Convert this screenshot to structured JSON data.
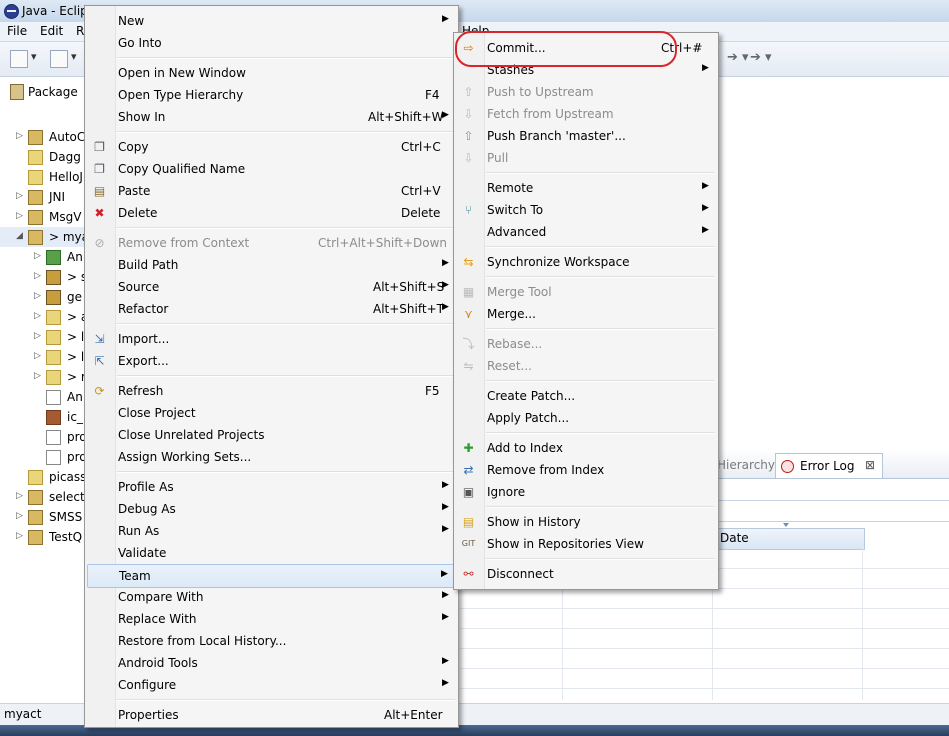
{
  "window": {
    "title": "Java - Eclip"
  },
  "menubar": {
    "items": [
      "File",
      "Edit",
      "R"
    ],
    "help": "Help"
  },
  "explorer": {
    "tab_label": "Package",
    "rows": [
      {
        "label": "AutoC",
        "top": 0
      },
      {
        "label": "Dagg",
        "top": 0
      },
      {
        "label": "HelloJ",
        "top": 0
      },
      {
        "label": "JNI",
        "top": 0
      },
      {
        "label": "MsgV",
        "top": 0
      },
      {
        "label": "> myac",
        "top": 0
      },
      {
        "label": "An",
        "top": 0
      },
      {
        "label": "> s",
        "top": 0
      },
      {
        "label": "ge",
        "top": 0
      },
      {
        "label": "> a",
        "top": 0
      },
      {
        "label": "> l",
        "top": 0
      },
      {
        "label": "> l",
        "top": 0
      },
      {
        "label": "> r",
        "top": 0
      },
      {
        "label": "An",
        "top": 0
      },
      {
        "label": "ic_",
        "top": 0
      },
      {
        "label": "pro",
        "top": 0
      },
      {
        "label": "pro",
        "top": 0
      },
      {
        "label": "picass",
        "top": 0
      },
      {
        "label": "select",
        "top": 0
      },
      {
        "label": "SMSS",
        "top": 0
      },
      {
        "label": "TestQ",
        "top": 0
      }
    ]
  },
  "context_menu": {
    "items": [
      {
        "label": "New",
        "shortcut": "",
        "submenu": true
      },
      {
        "label": "Go Into",
        "shortcut": ""
      },
      {
        "label": "Open in New Window",
        "shortcut": ""
      },
      {
        "label": "Open Type Hierarchy",
        "shortcut": "F4"
      },
      {
        "label": "Show In",
        "shortcut": "Alt+Shift+W",
        "submenu": true
      },
      {
        "label": "Copy",
        "shortcut": "Ctrl+C"
      },
      {
        "label": "Copy Qualified Name",
        "shortcut": ""
      },
      {
        "label": "Paste",
        "shortcut": "Ctrl+V"
      },
      {
        "label": "Delete",
        "shortcut": "Delete"
      },
      {
        "label": "Remove from Context",
        "shortcut": "Ctrl+Alt+Shift+Down",
        "disabled": true
      },
      {
        "label": "Build Path",
        "shortcut": "",
        "submenu": true
      },
      {
        "label": "Source",
        "shortcut": "Alt+Shift+S",
        "submenu": true
      },
      {
        "label": "Refactor",
        "shortcut": "Alt+Shift+T",
        "submenu": true
      },
      {
        "label": "Import...",
        "shortcut": ""
      },
      {
        "label": "Export...",
        "shortcut": ""
      },
      {
        "label": "Refresh",
        "shortcut": "F5"
      },
      {
        "label": "Close Project",
        "shortcut": ""
      },
      {
        "label": "Close Unrelated Projects",
        "shortcut": ""
      },
      {
        "label": "Assign Working Sets...",
        "shortcut": ""
      },
      {
        "label": "Profile As",
        "shortcut": "",
        "submenu": true
      },
      {
        "label": "Debug As",
        "shortcut": "",
        "submenu": true
      },
      {
        "label": "Run As",
        "shortcut": "",
        "submenu": true
      },
      {
        "label": "Validate",
        "shortcut": ""
      },
      {
        "label": "Team",
        "shortcut": "",
        "submenu": true,
        "highlighted": true
      },
      {
        "label": "Compare With",
        "shortcut": "",
        "submenu": true
      },
      {
        "label": "Replace With",
        "shortcut": "",
        "submenu": true
      },
      {
        "label": "Restore from Local History...",
        "shortcut": ""
      },
      {
        "label": "Android Tools",
        "shortcut": "",
        "submenu": true
      },
      {
        "label": "Configure",
        "shortcut": "",
        "submenu": true
      },
      {
        "label": "Properties",
        "shortcut": "Alt+Enter"
      }
    ]
  },
  "team_menu": {
    "items": [
      {
        "label": "Commit...",
        "shortcut": "Ctrl+#"
      },
      {
        "label": "Stashes",
        "shortcut": "",
        "submenu": true
      },
      {
        "label": "Push to Upstream",
        "shortcut": "",
        "disabled": true
      },
      {
        "label": "Fetch from Upstream",
        "shortcut": "",
        "disabled": true
      },
      {
        "label": "Push Branch 'master'...",
        "shortcut": ""
      },
      {
        "label": "Pull",
        "shortcut": "",
        "disabled": true
      },
      {
        "label": "Remote",
        "shortcut": "",
        "submenu": true
      },
      {
        "label": "Switch To",
        "shortcut": "",
        "submenu": true
      },
      {
        "label": "Advanced",
        "shortcut": "",
        "submenu": true
      },
      {
        "label": "Synchronize Workspace",
        "shortcut": ""
      },
      {
        "label": "Merge Tool",
        "shortcut": "",
        "disabled": true
      },
      {
        "label": "Merge...",
        "shortcut": ""
      },
      {
        "label": "Rebase...",
        "shortcut": "",
        "disabled": true
      },
      {
        "label": "Reset...",
        "shortcut": "",
        "disabled": true
      },
      {
        "label": "Create Patch...",
        "shortcut": ""
      },
      {
        "label": "Apply Patch...",
        "shortcut": ""
      },
      {
        "label": "Add to Index",
        "shortcut": ""
      },
      {
        "label": "Remove from Index",
        "shortcut": ""
      },
      {
        "label": "Ignore",
        "shortcut": ""
      },
      {
        "label": "Show in History",
        "shortcut": ""
      },
      {
        "label": "Show in Repositories View",
        "shortcut": ""
      },
      {
        "label": "Disconnect",
        "shortcut": ""
      }
    ]
  },
  "views": {
    "hierarchy_tab": "Hierarchy",
    "error_log_tab": "Error Log",
    "error_log_close": "⊠",
    "date_column": "Date"
  },
  "status": {
    "text": "myact"
  },
  "colors": {
    "annotation_circle": "#d9252c",
    "highlight": "#dce9f7"
  }
}
